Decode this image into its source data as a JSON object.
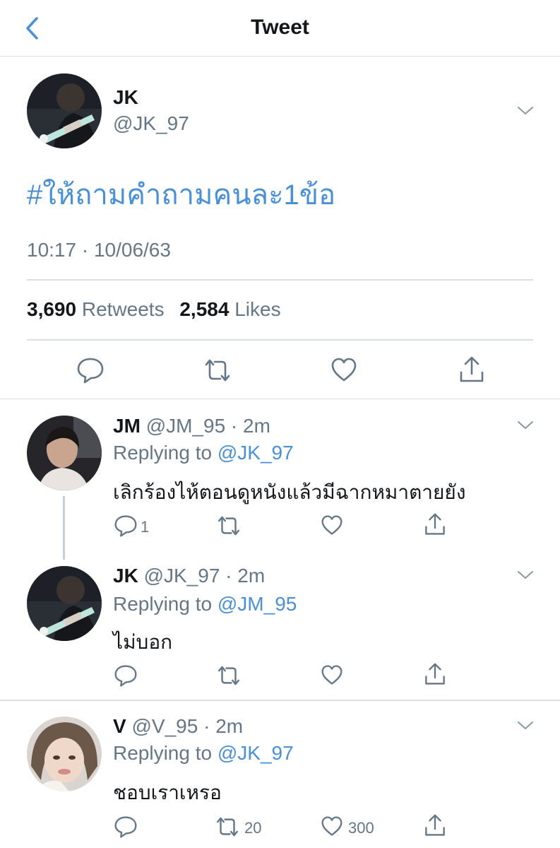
{
  "header": {
    "title": "Tweet"
  },
  "main_tweet": {
    "name": "JK",
    "handle": "@JK_97",
    "text": "#ให้ถามคำถามคนละ1ข้อ",
    "timestamp": "10:17 · 10/06/63",
    "retweets": "3,690",
    "retweets_label": "Retweets",
    "likes": "2,584",
    "likes_label": "Likes"
  },
  "replying_label": "Replying to",
  "replies": [
    {
      "name": "JM",
      "handle": "@JM_95",
      "time": "2m",
      "replying_to": "@JK_97",
      "text": "เลิกร้องไห้ตอนดูหนังแล้วมีฉากหมาตายยัง",
      "reply_count": "1",
      "retweet_count": "",
      "like_count": ""
    },
    {
      "name": "JK",
      "handle": "@JK_97",
      "time": "2m",
      "replying_to": "@JM_95",
      "text": "ไม่บอก",
      "reply_count": "",
      "retweet_count": "",
      "like_count": ""
    },
    {
      "name": "V",
      "handle": "@V_95",
      "time": "2m",
      "replying_to": "@JK_97",
      "text": "ชอบเราเหรอ",
      "reply_count": "",
      "retweet_count": "20",
      "like_count": "300"
    }
  ],
  "icons": {
    "back": "chevron-left-icon",
    "more": "chevron-down-icon",
    "reply": "comment-bubble-icon",
    "retweet": "retweet-icon",
    "like": "heart-icon",
    "share": "share-upload-icon"
  },
  "colors": {
    "accent": "#4a90d6",
    "secondary_text": "#657786",
    "divider": "#dcdfe2"
  }
}
